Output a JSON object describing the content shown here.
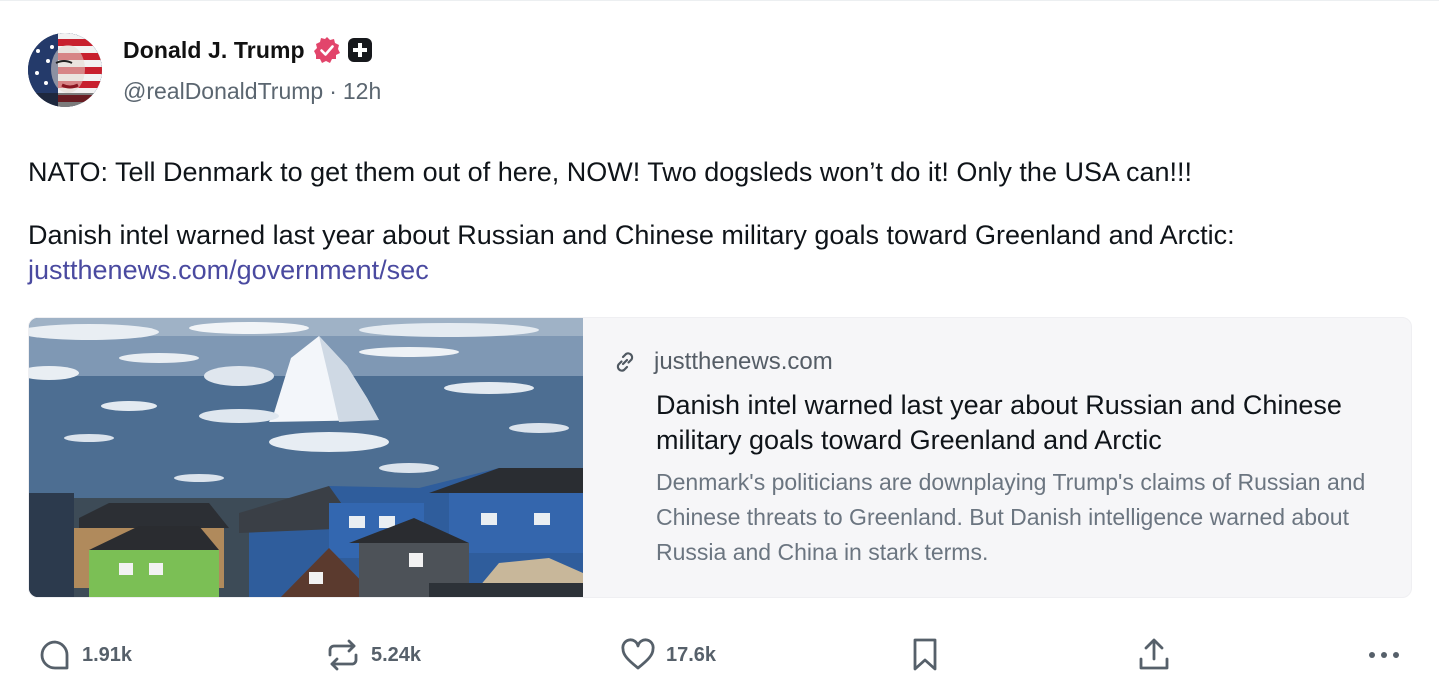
{
  "post": {
    "author": {
      "display_name": "Donald J. Trump",
      "handle": "@realDonaldTrump",
      "separator": "·",
      "time": "12h"
    },
    "text_line1": "NATO: Tell Denmark to get them out of here, NOW! Two dogsleds won’t do it! Only the USA can!!!",
    "text_line2": "Danish intel warned last year about Russian and Chinese military goals toward Greenland and Arctic:",
    "link_text": "justthenews.com/government/sec"
  },
  "card": {
    "domain": "justthenews.com",
    "title": "Danish intel warned last year about Russian and Chinese military goals toward Greenland and Arctic",
    "description": "Denmark's politicians are downplaying Trump's claims of Russian and Chinese threats to Greenland. But Danish intelligence warned about Russia and China in stark terms."
  },
  "actions": {
    "reply": {
      "icon": "reply-icon",
      "count": "1.91k"
    },
    "repost": {
      "icon": "repost-icon",
      "count": "5.24k"
    },
    "like": {
      "icon": "heart-icon",
      "count": "17.6k"
    },
    "bookmark": {
      "icon": "bookmark-icon"
    },
    "share": {
      "icon": "share-icon"
    },
    "more": {
      "icon": "more-icon"
    }
  },
  "colors": {
    "verified_badge": "#e2456b",
    "link": "#4a4aa0",
    "muted_text": "#5b6670",
    "card_background": "#f6f6f8"
  }
}
